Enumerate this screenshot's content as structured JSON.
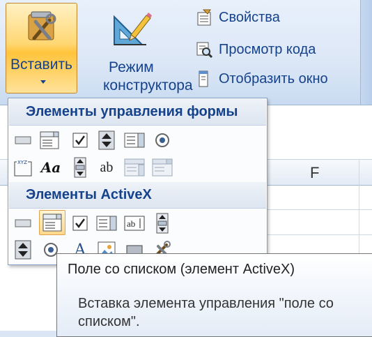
{
  "ribbon": {
    "insert_label": "Вставить",
    "design_mode_label_line1": "Режим",
    "design_mode_label_line2": "конструктора",
    "commands": [
      {
        "label": "Свойства",
        "icon": "properties-icon"
      },
      {
        "label": "Просмотр кода",
        "icon": "view-code-icon"
      },
      {
        "label": "Отобразить окно",
        "icon": "dialog-window-icon"
      }
    ]
  },
  "sheet": {
    "column_f": "F"
  },
  "dropdown": {
    "form_controls_title": "Элементы управления формы",
    "form_controls": [
      "button-icon",
      "combo-box-icon",
      "checkbox-icon",
      "spin-button-icon",
      "list-box-icon",
      "option-button-icon",
      "group-box-icon",
      "label-icon",
      "scroll-bar-icon",
      "text-field-icon",
      "combo-list-edit-icon",
      "combo-dropdown-edit-icon"
    ],
    "activex_title": "Элементы ActiveX",
    "activex_controls": [
      "button-icon",
      "combo-box-icon",
      "checkbox-icon",
      "list-box-icon",
      "text-box-icon",
      "scroll-bar-icon",
      "spin-button-icon",
      "option-button-icon",
      "label-icon",
      "image-icon",
      "toggle-button-icon",
      "more-controls-icon"
    ],
    "text_field_glyph": "ab",
    "label_glyph": "Aa",
    "activex_label_glyph": "A",
    "group_box_glyph": "XYZ"
  },
  "tooltip": {
    "title": "Поле со списком (элемент ActiveX)",
    "description": "Вставка элемента управления \"поле со списком\"."
  },
  "colors": {
    "ribbon_text": "#15428b",
    "highlight_orange": "#ffc43c"
  }
}
